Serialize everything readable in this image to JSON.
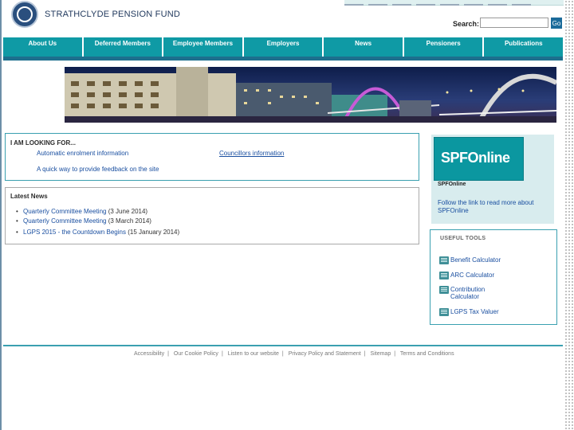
{
  "header": {
    "site_name": "STRATHCLYDE PENSION FUND",
    "search_label": "Search:",
    "search_value": "",
    "go_label": "Go"
  },
  "nav": [
    {
      "label": "About Us"
    },
    {
      "label": "Deferred Members"
    },
    {
      "label": "Employee Members"
    },
    {
      "label": "Employers"
    },
    {
      "label": "News"
    },
    {
      "label": "Pensioners"
    },
    {
      "label": "Publications"
    }
  ],
  "looking_for": {
    "title": "I AM LOOKING FOR...",
    "links": [
      {
        "label": "Automatic enrolment information"
      },
      {
        "label": "Councillors information"
      },
      {
        "label": "A quick way to provide feedback on the site"
      }
    ]
  },
  "latest_news": {
    "title": "Latest News",
    "items": [
      {
        "title": "Quarterly Committee Meeting",
        "date": "(3 June 2014)"
      },
      {
        "title": "Quarterly Committee Meeting",
        "date": "(3 March 2014)"
      },
      {
        "title": "LGPS 2015 - the Countdown Begins",
        "date": "(15 January 2014)"
      }
    ]
  },
  "spfonline": {
    "logo_text": "SPFOnline",
    "caption": "SPFOnline",
    "link": "Follow the link to read more about SPFOnline"
  },
  "useful_tools": {
    "title": "USEFUL TOOLS",
    "items": [
      {
        "label": "Benefit Calculator"
      },
      {
        "label": "ARC Calculator"
      },
      {
        "label": "Contribution Calculator"
      },
      {
        "label": "LGPS Tax Valuer"
      }
    ]
  },
  "footer": {
    "links": [
      {
        "label": "Accessibility"
      },
      {
        "label": "Our Cookie Policy"
      },
      {
        "label": "Listen to our website"
      },
      {
        "label": "Privacy Policy and Statement"
      },
      {
        "label": "Sitemap"
      },
      {
        "label": "Terms and Conditions"
      }
    ]
  },
  "colors": {
    "nav_teal": "#0f9aa5",
    "nav_underline": "#1d6f8d",
    "link_blue": "#1a4fa0",
    "panel_bg": "#d8ecee"
  }
}
